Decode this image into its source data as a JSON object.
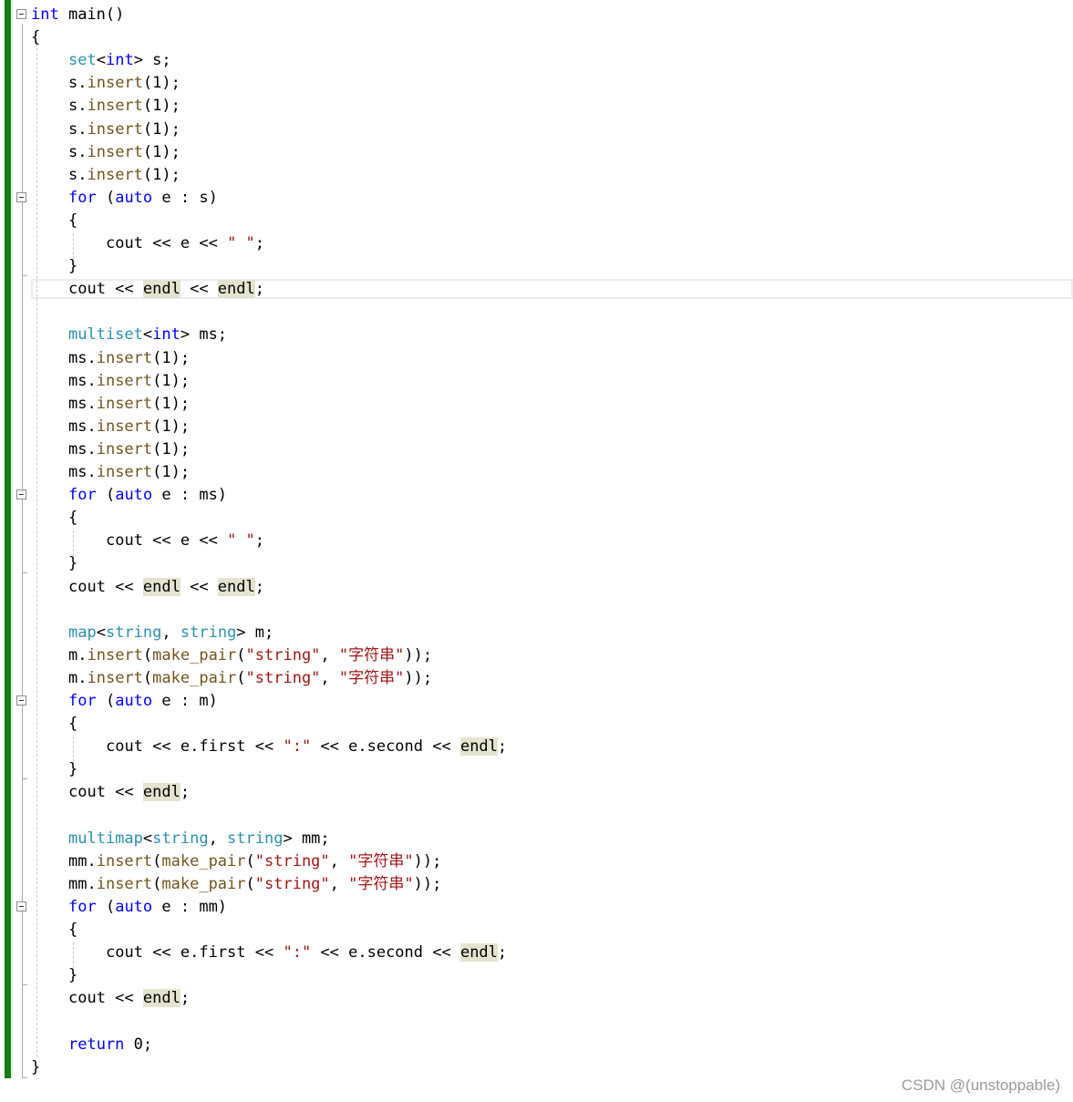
{
  "editor": {
    "lines": [
      {
        "indent": 0,
        "fold": true,
        "tokens": [
          {
            "t": "int",
            "c": "kw"
          },
          {
            "t": " main()",
            "c": ""
          }
        ]
      },
      {
        "indent": 0,
        "tokens": [
          {
            "t": "{",
            "c": ""
          }
        ]
      },
      {
        "indent": 1,
        "tokens": [
          {
            "t": "set",
            "c": "ty"
          },
          {
            "t": "<",
            "c": ""
          },
          {
            "t": "int",
            "c": "kw"
          },
          {
            "t": "> s;",
            "c": ""
          }
        ]
      },
      {
        "indent": 1,
        "tokens": [
          {
            "t": "s.",
            "c": ""
          },
          {
            "t": "insert",
            "c": "fn"
          },
          {
            "t": "(1);",
            "c": ""
          }
        ]
      },
      {
        "indent": 1,
        "tokens": [
          {
            "t": "s.",
            "c": ""
          },
          {
            "t": "insert",
            "c": "fn"
          },
          {
            "t": "(1);",
            "c": ""
          }
        ]
      },
      {
        "indent": 1,
        "tokens": [
          {
            "t": "s.",
            "c": ""
          },
          {
            "t": "insert",
            "c": "fn"
          },
          {
            "t": "(1);",
            "c": ""
          }
        ]
      },
      {
        "indent": 1,
        "tokens": [
          {
            "t": "s.",
            "c": ""
          },
          {
            "t": "insert",
            "c": "fn"
          },
          {
            "t": "(1);",
            "c": ""
          }
        ]
      },
      {
        "indent": 1,
        "tokens": [
          {
            "t": "s.",
            "c": ""
          },
          {
            "t": "insert",
            "c": "fn"
          },
          {
            "t": "(1);",
            "c": ""
          }
        ]
      },
      {
        "indent": 1,
        "fold": true,
        "tokens": [
          {
            "t": "for",
            "c": "kw"
          },
          {
            "t": " (",
            "c": ""
          },
          {
            "t": "auto",
            "c": "kw"
          },
          {
            "t": " e : s)",
            "c": ""
          }
        ]
      },
      {
        "indent": 1,
        "tokens": [
          {
            "t": "{",
            "c": ""
          }
        ]
      },
      {
        "indent": 2,
        "tokens": [
          {
            "t": "cout << e << ",
            "c": ""
          },
          {
            "t": "\" \"",
            "c": "str"
          },
          {
            "t": ";",
            "c": ""
          }
        ]
      },
      {
        "indent": 1,
        "tokens": [
          {
            "t": "}",
            "c": ""
          }
        ]
      },
      {
        "indent": 1,
        "tokens": [
          {
            "t": "cout << ",
            "c": ""
          },
          {
            "t": "endl",
            "c": "hl"
          },
          {
            "t": " << ",
            "c": ""
          },
          {
            "t": "endl",
            "c": "hl"
          },
          {
            "t": ";",
            "c": ""
          }
        ]
      },
      {
        "indent": 1,
        "tokens": []
      },
      {
        "indent": 1,
        "tokens": [
          {
            "t": "multiset",
            "c": "ty"
          },
          {
            "t": "<",
            "c": ""
          },
          {
            "t": "int",
            "c": "kw"
          },
          {
            "t": "> ms;",
            "c": ""
          }
        ]
      },
      {
        "indent": 1,
        "tokens": [
          {
            "t": "ms.",
            "c": ""
          },
          {
            "t": "insert",
            "c": "fn"
          },
          {
            "t": "(1);",
            "c": ""
          }
        ]
      },
      {
        "indent": 1,
        "tokens": [
          {
            "t": "ms.",
            "c": ""
          },
          {
            "t": "insert",
            "c": "fn"
          },
          {
            "t": "(1);",
            "c": ""
          }
        ]
      },
      {
        "indent": 1,
        "tokens": [
          {
            "t": "ms.",
            "c": ""
          },
          {
            "t": "insert",
            "c": "fn"
          },
          {
            "t": "(1);",
            "c": ""
          }
        ]
      },
      {
        "indent": 1,
        "tokens": [
          {
            "t": "ms.",
            "c": ""
          },
          {
            "t": "insert",
            "c": "fn"
          },
          {
            "t": "(1);",
            "c": ""
          }
        ]
      },
      {
        "indent": 1,
        "tokens": [
          {
            "t": "ms.",
            "c": ""
          },
          {
            "t": "insert",
            "c": "fn"
          },
          {
            "t": "(1);",
            "c": ""
          }
        ]
      },
      {
        "indent": 1,
        "tokens": [
          {
            "t": "ms.",
            "c": ""
          },
          {
            "t": "insert",
            "c": "fn"
          },
          {
            "t": "(1);",
            "c": ""
          }
        ]
      },
      {
        "indent": 1,
        "fold": true,
        "tokens": [
          {
            "t": "for",
            "c": "kw"
          },
          {
            "t": " (",
            "c": ""
          },
          {
            "t": "auto",
            "c": "kw"
          },
          {
            "t": " e : ms)",
            "c": ""
          }
        ]
      },
      {
        "indent": 1,
        "tokens": [
          {
            "t": "{",
            "c": ""
          }
        ]
      },
      {
        "indent": 2,
        "tokens": [
          {
            "t": "cout << e << ",
            "c": ""
          },
          {
            "t": "\" \"",
            "c": "str"
          },
          {
            "t": ";",
            "c": ""
          }
        ]
      },
      {
        "indent": 1,
        "tokens": [
          {
            "t": "}",
            "c": ""
          }
        ]
      },
      {
        "indent": 1,
        "tokens": [
          {
            "t": "cout << ",
            "c": ""
          },
          {
            "t": "endl",
            "c": "hl"
          },
          {
            "t": " << ",
            "c": ""
          },
          {
            "t": "endl",
            "c": "hl"
          },
          {
            "t": ";",
            "c": ""
          }
        ]
      },
      {
        "indent": 1,
        "tokens": []
      },
      {
        "indent": 1,
        "tokens": [
          {
            "t": "map",
            "c": "ty"
          },
          {
            "t": "<",
            "c": ""
          },
          {
            "t": "string",
            "c": "ty"
          },
          {
            "t": ", ",
            "c": ""
          },
          {
            "t": "string",
            "c": "ty"
          },
          {
            "t": "> m;",
            "c": ""
          }
        ]
      },
      {
        "indent": 1,
        "tokens": [
          {
            "t": "m.",
            "c": ""
          },
          {
            "t": "insert",
            "c": "fn"
          },
          {
            "t": "(",
            "c": ""
          },
          {
            "t": "make_pair",
            "c": "fn"
          },
          {
            "t": "(",
            "c": ""
          },
          {
            "t": "\"string\"",
            "c": "str"
          },
          {
            "t": ", ",
            "c": ""
          },
          {
            "t": "\"字符串\"",
            "c": "str"
          },
          {
            "t": "));",
            "c": ""
          }
        ]
      },
      {
        "indent": 1,
        "tokens": [
          {
            "t": "m.",
            "c": ""
          },
          {
            "t": "insert",
            "c": "fn"
          },
          {
            "t": "(",
            "c": ""
          },
          {
            "t": "make_pair",
            "c": "fn"
          },
          {
            "t": "(",
            "c": ""
          },
          {
            "t": "\"string\"",
            "c": "str"
          },
          {
            "t": ", ",
            "c": ""
          },
          {
            "t": "\"字符串\"",
            "c": "str"
          },
          {
            "t": "));",
            "c": ""
          }
        ]
      },
      {
        "indent": 1,
        "fold": true,
        "tokens": [
          {
            "t": "for",
            "c": "kw"
          },
          {
            "t": " (",
            "c": ""
          },
          {
            "t": "auto",
            "c": "kw"
          },
          {
            "t": " e : m)",
            "c": ""
          }
        ]
      },
      {
        "indent": 1,
        "tokens": [
          {
            "t": "{",
            "c": ""
          }
        ]
      },
      {
        "indent": 2,
        "tokens": [
          {
            "t": "cout << e.first << ",
            "c": ""
          },
          {
            "t": "\":\"",
            "c": "str"
          },
          {
            "t": " << e.second << ",
            "c": ""
          },
          {
            "t": "endl",
            "c": "hl"
          },
          {
            "t": ";",
            "c": ""
          }
        ]
      },
      {
        "indent": 1,
        "tokens": [
          {
            "t": "}",
            "c": ""
          }
        ]
      },
      {
        "indent": 1,
        "tokens": [
          {
            "t": "cout << ",
            "c": ""
          },
          {
            "t": "endl",
            "c": "hl"
          },
          {
            "t": ";",
            "c": ""
          }
        ]
      },
      {
        "indent": 1,
        "tokens": []
      },
      {
        "indent": 1,
        "tokens": [
          {
            "t": "multimap",
            "c": "ty"
          },
          {
            "t": "<",
            "c": ""
          },
          {
            "t": "string",
            "c": "ty"
          },
          {
            "t": ", ",
            "c": ""
          },
          {
            "t": "string",
            "c": "ty"
          },
          {
            "t": "> mm;",
            "c": ""
          }
        ]
      },
      {
        "indent": 1,
        "tokens": [
          {
            "t": "mm.",
            "c": ""
          },
          {
            "t": "insert",
            "c": "fn"
          },
          {
            "t": "(",
            "c": ""
          },
          {
            "t": "make_pair",
            "c": "fn"
          },
          {
            "t": "(",
            "c": ""
          },
          {
            "t": "\"string\"",
            "c": "str"
          },
          {
            "t": ", ",
            "c": ""
          },
          {
            "t": "\"字符串\"",
            "c": "str"
          },
          {
            "t": "));",
            "c": ""
          }
        ]
      },
      {
        "indent": 1,
        "tokens": [
          {
            "t": "mm.",
            "c": ""
          },
          {
            "t": "insert",
            "c": "fn"
          },
          {
            "t": "(",
            "c": ""
          },
          {
            "t": "make_pair",
            "c": "fn"
          },
          {
            "t": "(",
            "c": ""
          },
          {
            "t": "\"string\"",
            "c": "str"
          },
          {
            "t": ", ",
            "c": ""
          },
          {
            "t": "\"字符串\"",
            "c": "str"
          },
          {
            "t": "));",
            "c": ""
          }
        ]
      },
      {
        "indent": 1,
        "fold": true,
        "tokens": [
          {
            "t": "for",
            "c": "kw"
          },
          {
            "t": " (",
            "c": ""
          },
          {
            "t": "auto",
            "c": "kw"
          },
          {
            "t": " e : mm)",
            "c": ""
          }
        ]
      },
      {
        "indent": 1,
        "tokens": [
          {
            "t": "{",
            "c": ""
          }
        ]
      },
      {
        "indent": 2,
        "tokens": [
          {
            "t": "cout << e.first << ",
            "c": ""
          },
          {
            "t": "\":\"",
            "c": "str"
          },
          {
            "t": " << e.second << ",
            "c": ""
          },
          {
            "t": "endl",
            "c": "hl"
          },
          {
            "t": ";",
            "c": ""
          }
        ]
      },
      {
        "indent": 1,
        "tokens": [
          {
            "t": "}",
            "c": ""
          }
        ]
      },
      {
        "indent": 1,
        "tokens": [
          {
            "t": "cout << ",
            "c": ""
          },
          {
            "t": "endl",
            "c": "hl"
          },
          {
            "t": ";",
            "c": ""
          }
        ]
      },
      {
        "indent": 1,
        "tokens": []
      },
      {
        "indent": 1,
        "tokens": [
          {
            "t": "return",
            "c": "kw"
          },
          {
            "t": " 0;",
            "c": ""
          }
        ]
      },
      {
        "indent": 0,
        "tokens": [
          {
            "t": "}",
            "c": ""
          }
        ]
      }
    ]
  },
  "colors": {
    "keyword": "#0000ff",
    "type": "#2b91af",
    "string": "#a31515",
    "function": "#74531f",
    "change_bar": "#108010",
    "endl_highlight": "#e3e3cf"
  },
  "watermark": "CSDN @(unstoppable)"
}
